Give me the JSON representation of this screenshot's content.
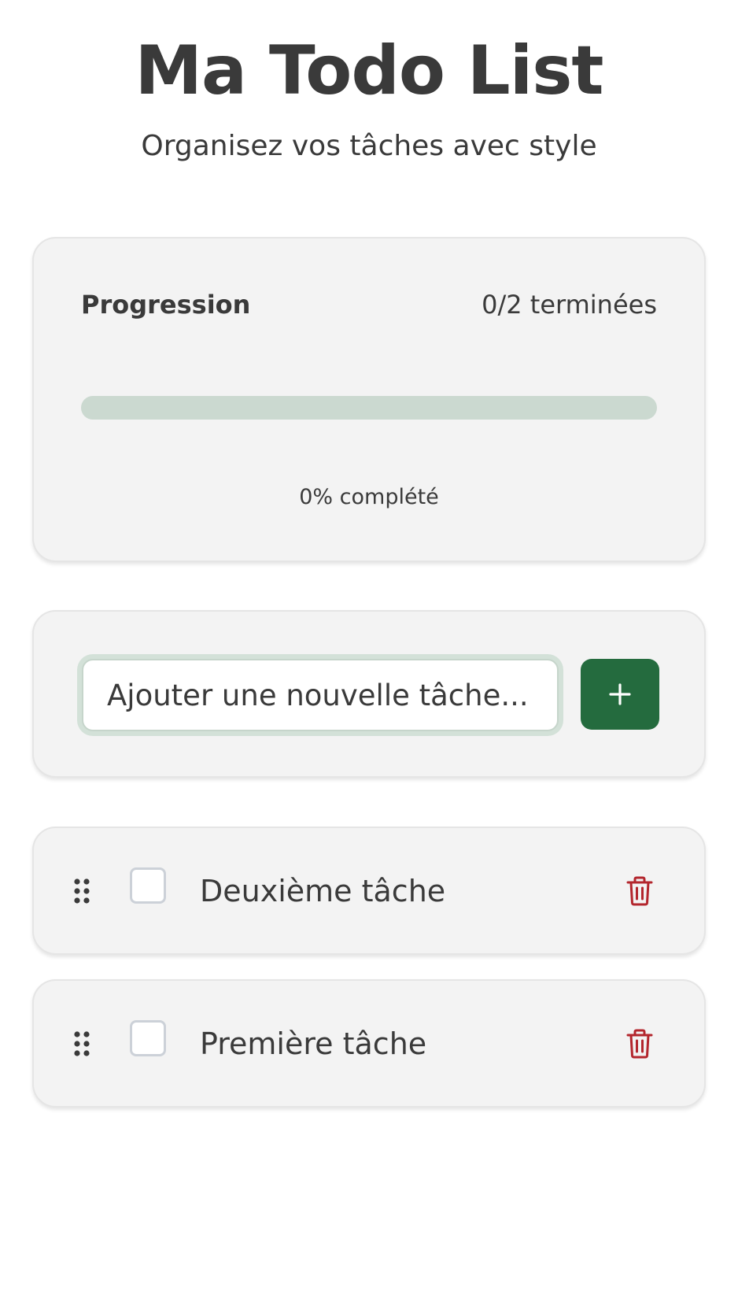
{
  "header": {
    "title": "Ma Todo List",
    "subtitle": "Organisez vos tâches avec style"
  },
  "progress": {
    "label": "Progression",
    "count_text": "0/2 terminées",
    "percent_text": "0% complété",
    "completed_fraction": 0,
    "track_color": "#cbd9d0",
    "fill_color": "#246b3e"
  },
  "new_task": {
    "placeholder": "Ajouter une nouvelle tâche... (",
    "value": "",
    "add_button_icon": "plus-icon",
    "accent_color": "#246b3e"
  },
  "tasks": [
    {
      "text": "Deuxième tâche",
      "completed": false,
      "handle_icon": "drag-handle-icon",
      "delete_icon": "trash-icon"
    },
    {
      "text": "Première tâche",
      "completed": false,
      "handle_icon": "drag-handle-icon",
      "delete_icon": "trash-icon"
    }
  ],
  "colors": {
    "card_bg": "#f3f3f3",
    "text": "#3a3a3a",
    "delete": "#b3262d"
  }
}
